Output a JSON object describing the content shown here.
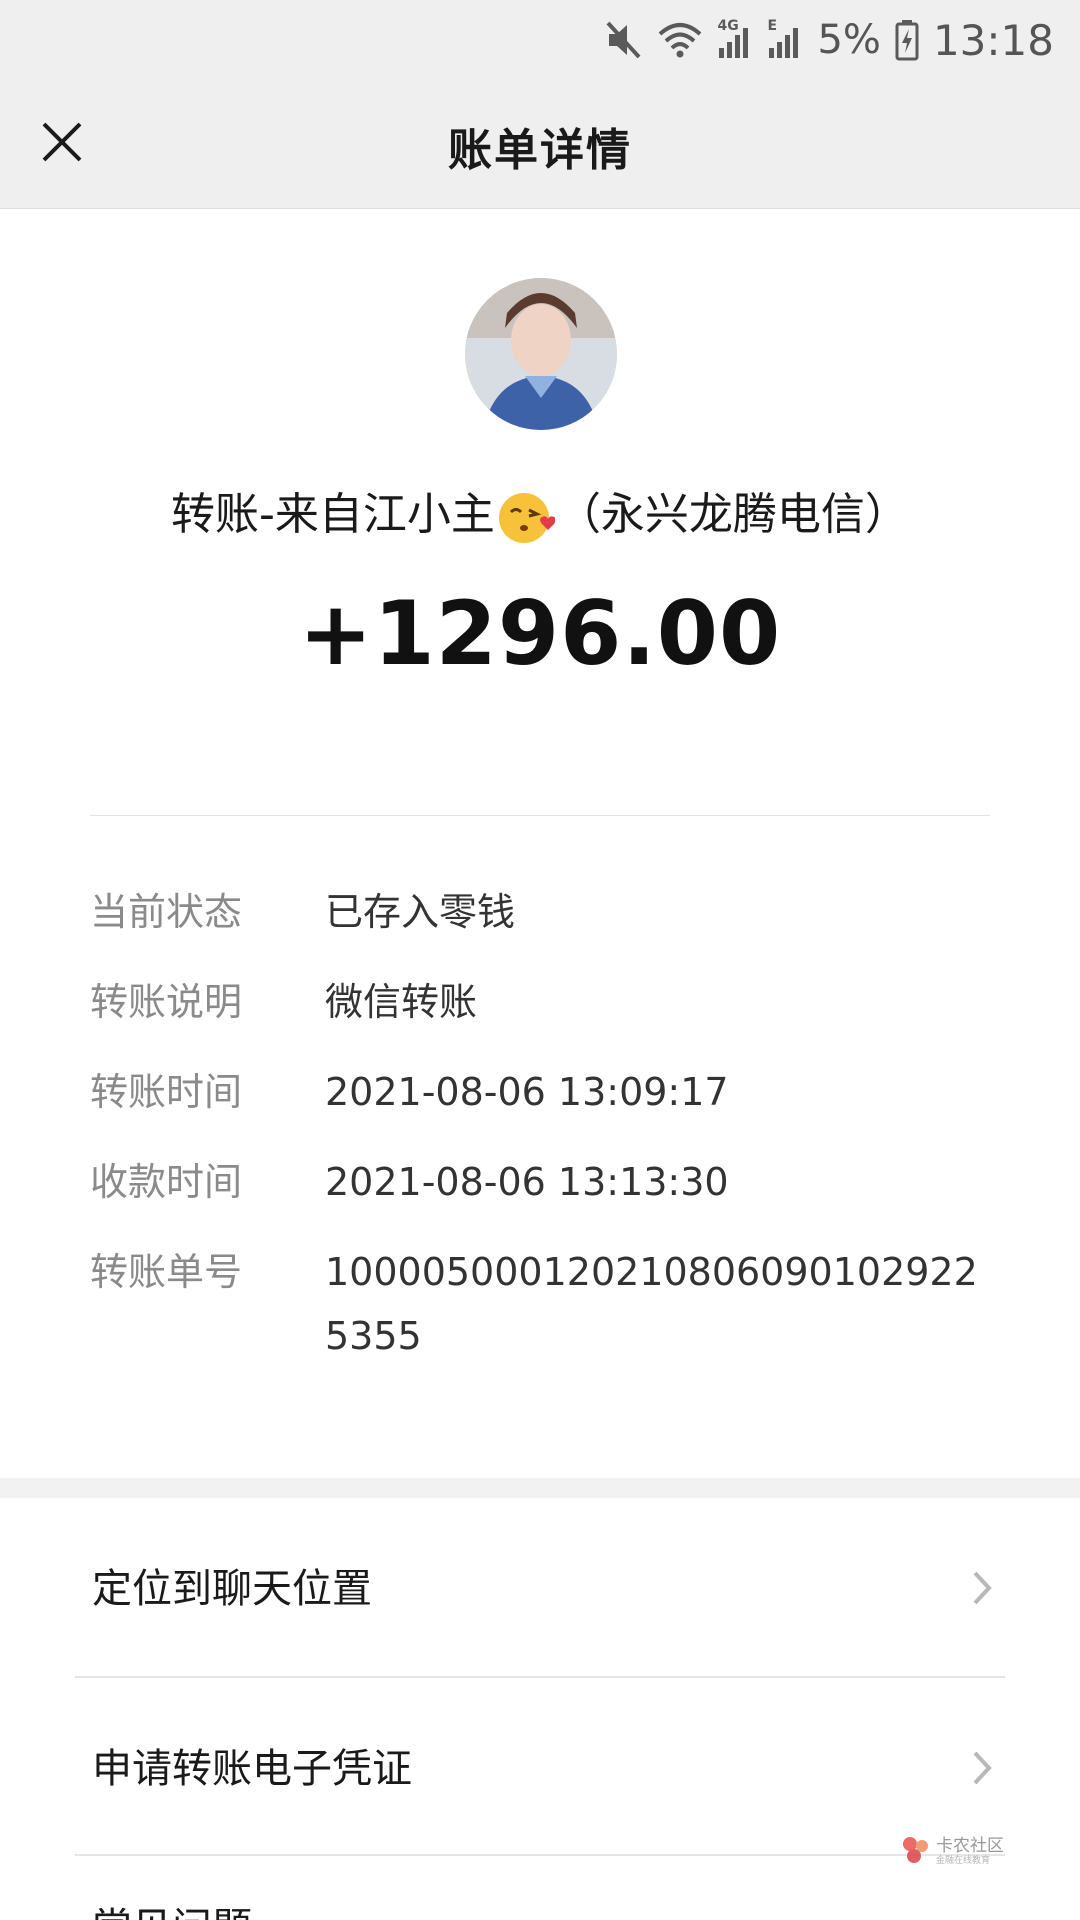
{
  "status_bar": {
    "icons": [
      "mute-icon",
      "wifi-icon",
      "signal-4g-icon",
      "signal-e-icon",
      "battery-icon"
    ],
    "network_4g": "4G",
    "network_e": "E",
    "battery_percent": "5%",
    "time": "13:18"
  },
  "nav": {
    "title": "账单详情",
    "close_icon": "close-icon"
  },
  "payer": {
    "name_prefix": "转账-来自江小主",
    "emoji": "kissing-face-emoji",
    "name_suffix": "（永兴龙腾电信）"
  },
  "amount": "+1296.00",
  "details": [
    {
      "label": "当前状态",
      "value": "已存入零钱"
    },
    {
      "label": "转账说明",
      "value": "微信转账"
    },
    {
      "label": "转账时间",
      "value": "2021-08-06 13:09:17"
    },
    {
      "label": "收款时间",
      "value": "2021-08-06 13:13:30"
    },
    {
      "label": "转账单号",
      "value": "1000050001202108060901029225355"
    }
  ],
  "menu": [
    {
      "label": "定位到聊天位置",
      "icon": "chevron-right-icon"
    },
    {
      "label": "申请转账电子凭证",
      "icon": "chevron-right-icon"
    }
  ],
  "partial_menu_item": "常见问题",
  "watermark": {
    "main": "卡农社区",
    "sub": "金融在线教育"
  },
  "colors": {
    "header_bg": "#efefef",
    "label_gray": "#8a8a8a",
    "amount": "#111111"
  }
}
